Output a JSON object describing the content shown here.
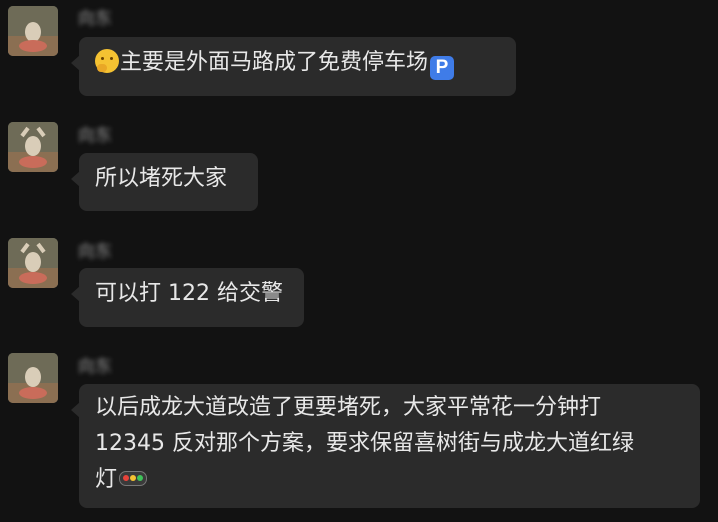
{
  "messages": [
    {
      "sender": "向东",
      "text": "主要是外面马路成了免费停车场",
      "leading_emoji": "thinking-face-icon",
      "trailing_emoji": "parking-icon",
      "trailing_emoji_text": "P"
    },
    {
      "sender": "向东",
      "text": "所以堵死大家"
    },
    {
      "sender": "向东",
      "text": "可以打 122 给交警"
    },
    {
      "sender": "向东",
      "lines": [
        "以后成龙大道改造了更要堵死，大家平常花一分钟打",
        "12345 反对那个方案，要求保留喜树街与成龙大道红绿",
        "灯"
      ],
      "trailing_emoji": "traffic-light-icon"
    }
  ],
  "colors": {
    "background": "#121212",
    "bubble": "#2b2b2b",
    "text": "#e8e8e8",
    "sender": "#8f8f8f",
    "parking_badge": "#3f7ce8",
    "traffic_red": "#e8433a",
    "traffic_yellow": "#f5c232",
    "traffic_green": "#3fc35a"
  }
}
